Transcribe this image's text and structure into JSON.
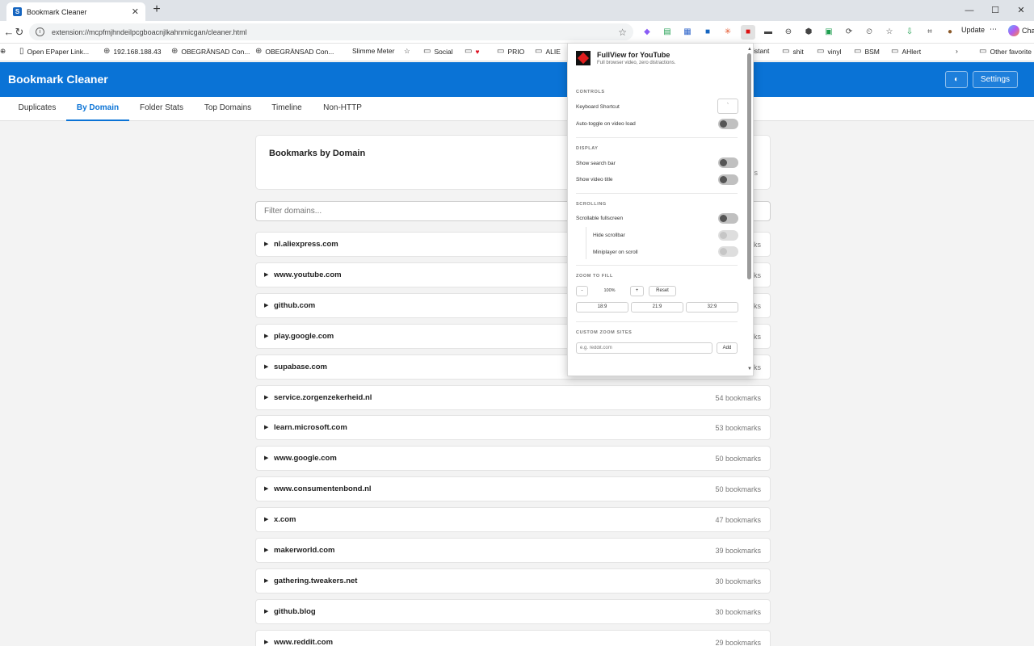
{
  "browser": {
    "tab_title": "Bookmark Cleaner",
    "tab_favicon": "S",
    "tab_close": "✕",
    "new_tab": "+",
    "url": "extension://mcpfmjhndeilpcgboacnjlkahnmicgan/cleaner.html",
    "update_label": "Update",
    "copilot_label": "Cha",
    "bookmarks": [
      "Open EPaper Link...",
      "192.168.188.43",
      "OBEGRÄNSAD Con...",
      "OBEGRÄNSAD Con...",
      "Slimme Meter",
      "Social",
      "PRIO",
      "ALIE",
      "istant",
      "shit",
      "vinyl",
      "BSM",
      "AHlert",
      "Other favorite"
    ]
  },
  "app": {
    "title": "Bookmark Cleaner",
    "theme_icon": "◐",
    "settings_label": "Settings",
    "tabs": [
      "Duplicates",
      "By Domain",
      "Folder Stats",
      "Top Domains",
      "Timeline",
      "Non-HTTP"
    ],
    "active_tab": "By Domain",
    "section_title": "Bookmarks by Domain",
    "panel_peek": "s",
    "filter_placeholder": "Filter domains...",
    "domains": [
      {
        "name": "nl.aliexpress.com",
        "count": "rks"
      },
      {
        "name": "www.youtube.com",
        "count": "rks"
      },
      {
        "name": "github.com",
        "count": "rks"
      },
      {
        "name": "play.google.com",
        "count": "rks"
      },
      {
        "name": "supabase.com",
        "count": "rks"
      },
      {
        "name": "service.zorgenzekerheid.nl",
        "count": "54 bookmarks"
      },
      {
        "name": "learn.microsoft.com",
        "count": "53 bookmarks"
      },
      {
        "name": "www.google.com",
        "count": "50 bookmarks"
      },
      {
        "name": "www.consumentenbond.nl",
        "count": "50 bookmarks"
      },
      {
        "name": "x.com",
        "count": "47 bookmarks"
      },
      {
        "name": "makerworld.com",
        "count": "39 bookmarks"
      },
      {
        "name": "gathering.tweakers.net",
        "count": "30 bookmarks"
      },
      {
        "name": "github.blog",
        "count": "30 bookmarks"
      },
      {
        "name": "www.reddit.com",
        "count": "29 bookmarks"
      }
    ]
  },
  "popup": {
    "title": "FullView for YouTube",
    "subtitle": "Full browser video, zero distractions.",
    "controls_label": "CONTROLS",
    "keyboard_shortcut_label": "Keyboard Shortcut",
    "keyboard_shortcut_value": "`",
    "auto_toggle_label": "Auto-toggle on video load",
    "display_label": "DISPLAY",
    "show_search_label": "Show search bar",
    "show_title_label": "Show video title",
    "scrolling_label": "SCROLLING",
    "scrollable_label": "Scrollable fullscreen",
    "hide_scrollbar_label": "Hide scrollbar",
    "miniplayer_label": "Miniplayer on scroll",
    "zoom_label": "ZOOM TO FILL",
    "zoom_minus": "-",
    "zoom_value": "100%",
    "zoom_plus": "+",
    "zoom_reset": "Reset",
    "ratios": [
      "18:9",
      "21:9",
      "32:9"
    ],
    "custom_label": "CUSTOM ZOOM SITES",
    "custom_placeholder": "e.g. reddit.com",
    "add_label": "Add"
  },
  "colors": {
    "accent": "#0a73d6",
    "popup_logo_red": "#e01e1e"
  },
  "icons": [
    "reload-icon",
    "info-icon",
    "star-icon",
    "folder-icon",
    "globe-icon",
    "more-icon"
  ]
}
